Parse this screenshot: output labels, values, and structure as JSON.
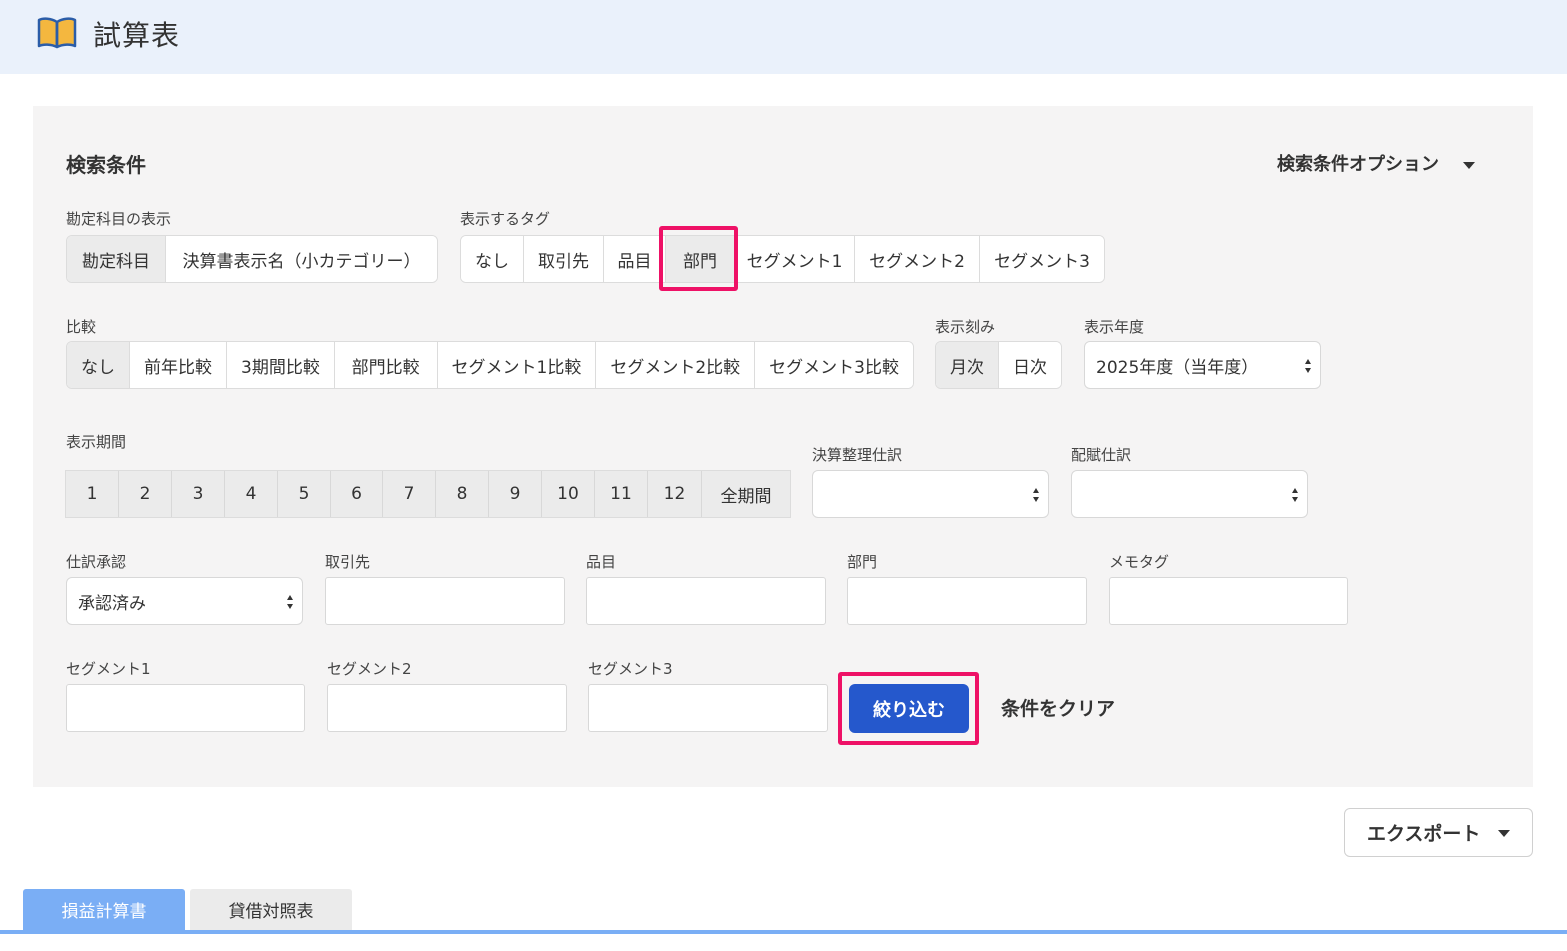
{
  "page": {
    "title": "試算表"
  },
  "search": {
    "title": "検索条件",
    "options_label": "検索条件オプション",
    "account_display": {
      "label": "勘定科目の表示",
      "options": [
        "勘定科目",
        "決算書表示名（小カテゴリー）"
      ],
      "selected": "勘定科目"
    },
    "tags": {
      "label": "表示するタグ",
      "options": [
        "なし",
        "取引先",
        "品目",
        "部門",
        "セグメント1",
        "セグメント2",
        "セグメント3"
      ],
      "selected": "部門"
    },
    "compare": {
      "label": "比較",
      "options": [
        "なし",
        "前年比較",
        "3期間比較",
        "部門比較",
        "セグメント1比較",
        "セグメント2比較",
        "セグメント3比較"
      ],
      "selected": "なし"
    },
    "granularity": {
      "label": "表示刻み",
      "options": [
        "月次",
        "日次"
      ],
      "selected": "月次"
    },
    "fiscal_year": {
      "label": "表示年度",
      "value": "2025年度（当年度）"
    },
    "period": {
      "label": "表示期間",
      "options": [
        "1",
        "2",
        "3",
        "4",
        "5",
        "6",
        "7",
        "8",
        "9",
        "10",
        "11",
        "12",
        "全期間"
      ]
    },
    "closing_entries": {
      "label": "決算整理仕訳",
      "value": ""
    },
    "allocation_entries": {
      "label": "配賦仕訳",
      "value": ""
    },
    "approval": {
      "label": "仕訳承認",
      "value": "承認済み"
    },
    "partner": {
      "label": "取引先",
      "value": ""
    },
    "item": {
      "label": "品目",
      "value": ""
    },
    "department": {
      "label": "部門",
      "value": ""
    },
    "memo_tag": {
      "label": "メモタグ",
      "value": ""
    },
    "segment1": {
      "label": "セグメント1",
      "value": ""
    },
    "segment2": {
      "label": "セグメント2",
      "value": ""
    },
    "segment3": {
      "label": "セグメント3",
      "value": ""
    },
    "filter_button": "絞り込む",
    "clear_link": "条件をクリア"
  },
  "export": {
    "label": "エクスポート"
  },
  "tabs": [
    {
      "label": "損益計算書",
      "active": true
    },
    {
      "label": "貸借対照表",
      "active": false
    }
  ],
  "colors": {
    "header_bg": "#eaf1fb",
    "panel_bg": "#f5f4f4",
    "primary": "#2558cc",
    "highlight": "#ee1166",
    "tab_active": "#7aaef5",
    "book_icon": "#f4b73f"
  }
}
